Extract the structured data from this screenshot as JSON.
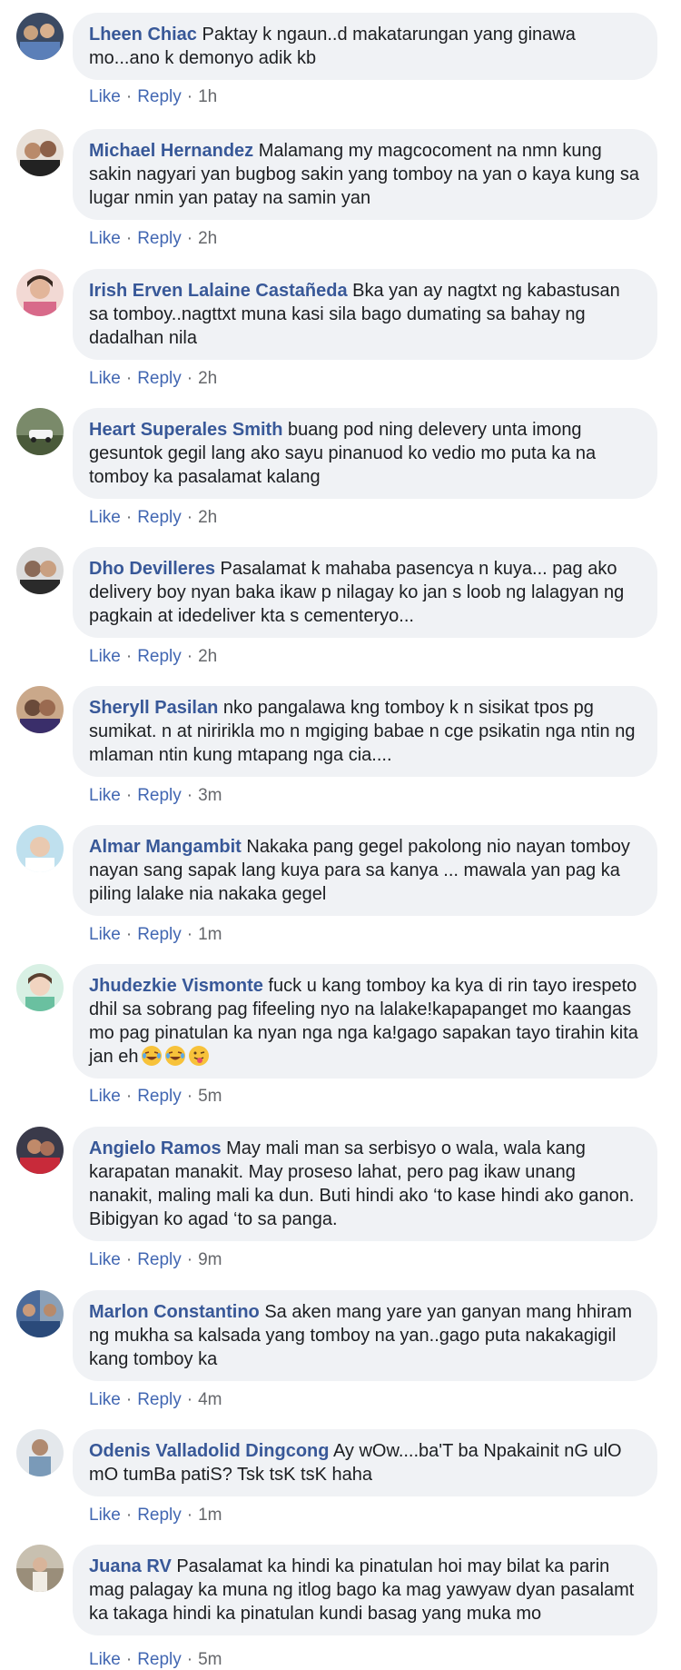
{
  "actions": {
    "like": "Like",
    "reply": "Reply",
    "sep": "·"
  },
  "comments": [
    {
      "author": "Lheen Chiac",
      "text": "Paktay k ngaun..d makatarungan yang ginawa mo...ano k demonyo adik kb",
      "time": "1h"
    },
    {
      "author": "Michael Hernandez",
      "text": "Malamang my magcocoment na nmn kung sakin nagyari yan bugbog sakin yang tomboy na yan o kaya kung sa lugar nmin yan patay na samin yan",
      "time": "2h"
    },
    {
      "author": "Irish Erven Lalaine Castañeda",
      "text": "Bka yan ay nagtxt ng kabastusan sa tomboy..nagttxt muna kasi sila bago dumating sa bahay ng dadalhan nila",
      "time": "2h"
    },
    {
      "author": "Heart Superales Smith",
      "text": "buang pod ning delevery unta imong gesuntok gegil lang ako sayu pinanuod ko vedio mo puta ka na tomboy ka pasalamat kalang",
      "time": "2h"
    },
    {
      "author": "Dho Devilleres",
      "text": "Pasalamat k mahaba pasencya n kuya... pag ako delivery boy nyan baka ikaw p nilagay ko jan s loob ng lalagyan ng pagkain at idedeliver kta s cementeryo...",
      "time": "2h"
    },
    {
      "author": "Sheryll Pasilan",
      "text": "nko pangalawa kng tomboy k n sisikat tpos pg sumikat. n at niririkla mo n mgiging babae n cge psikatin nga ntin ng mlaman ntin kung mtapang nga cia....",
      "time": "3m"
    },
    {
      "author": "Almar Mangambit",
      "text": "Nakaka pang gegel pakolong nio nayan tomboy nayan sang sapak lang kuya para sa kanya ... mawala yan pag ka piling lalake nia nakaka gegel",
      "time": "1m"
    },
    {
      "author": "Jhudezkie Vismonte",
      "text": "fuck u kang tomboy ka kya di rin tayo irespeto dhil sa sobrang pag fifeeling nyo na lalake!kapapanget mo kaangas mo pag pinatulan ka nyan nga nga ka!gago sapakan tayo tirahin kita jan eh",
      "time": "5m",
      "emojis": [
        "joy",
        "joy",
        "tongue"
      ]
    },
    {
      "author": "Angielo Ramos",
      "text": "May mali man sa serbisyo o wala, wala kang karapatan manakit. May proseso lahat, pero pag ikaw unang nanakit, maling mali ka dun. Buti hindi ako ‘to kase hindi ako ganon. Bibigyan ko agad ‘to sa panga.",
      "time": "9m"
    },
    {
      "author": "Marlon Constantino",
      "text": "Sa aken mang yare yan ganyan mang hhiram ng mukha sa kalsada yang tomboy na yan..gago puta nakakagigil kang tomboy ka",
      "time": "4m"
    },
    {
      "author": "Odenis Valladolid Dingcong",
      "text": "Ay wOw....ba'T ba Npakainit nG ulO mO tumBa patiS? Tsk tsK tsK haha",
      "time": "1m"
    },
    {
      "author": "Juana RV",
      "text": "Pasalamat ka hindi ka pinatulan hoi may bilat ka parin mag palagay ka muna ng itlog bago ka mag yawyaw dyan pasalamt ka takaga hindi ka pinatulan kundi basag yang muka mo",
      "time": "5m"
    }
  ]
}
